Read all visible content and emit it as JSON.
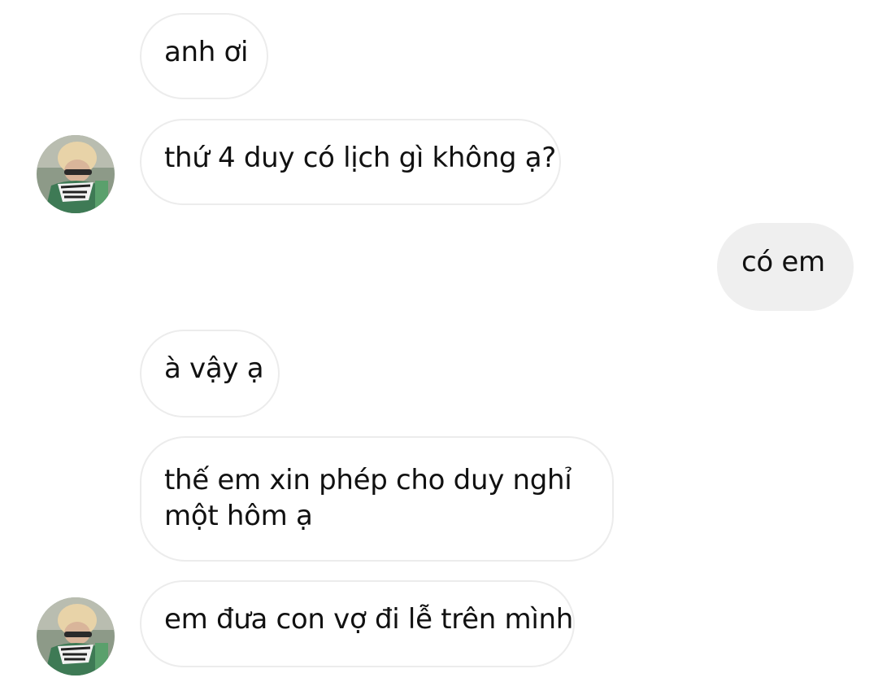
{
  "messages": [
    {
      "sender": "contact",
      "text": "anh ơi"
    },
    {
      "sender": "contact",
      "text": "thứ 4 duy có lịch gì không ạ?",
      "avatar": true
    },
    {
      "sender": "me",
      "text": "có em"
    },
    {
      "sender": "contact",
      "text": "à vậy ạ"
    },
    {
      "sender": "contact",
      "text": "thế em xin phép cho duy nghỉ một hôm ạ"
    },
    {
      "sender": "contact",
      "text": "em đưa con vợ đi lễ trên mình",
      "avatar": true
    }
  ]
}
